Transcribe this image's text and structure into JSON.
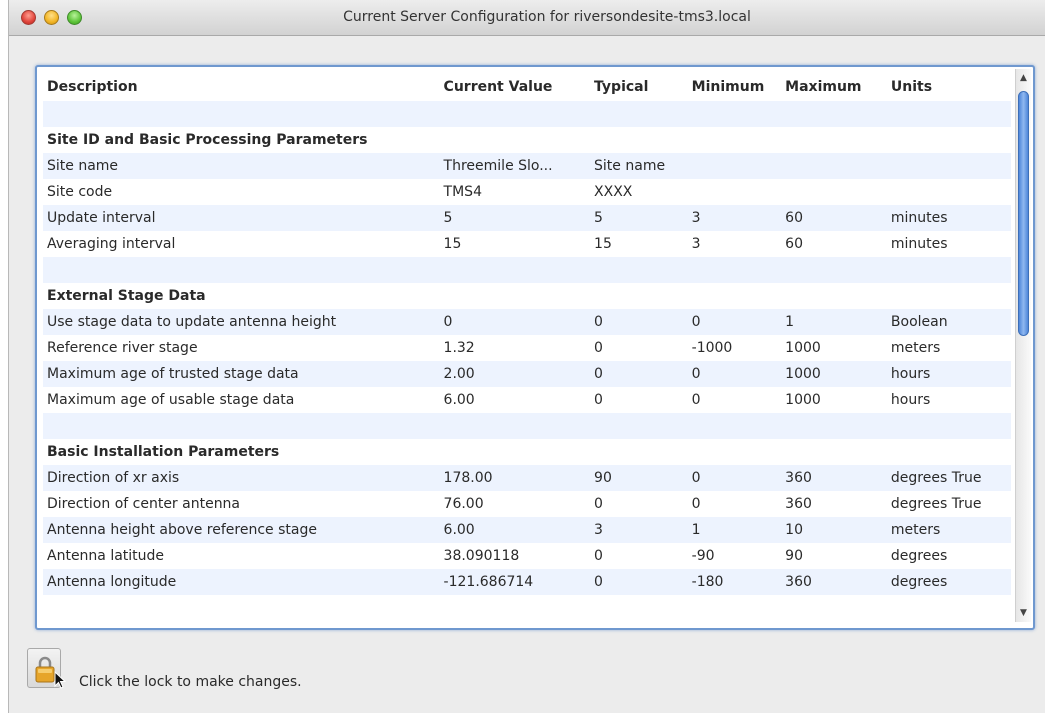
{
  "window": {
    "title": "Current Server Configuration for riversondesite-tms3.local"
  },
  "table": {
    "headers": [
      "Description",
      "Current Value",
      "Typical",
      "Minimum",
      "Maximum",
      "Units"
    ],
    "rows": [
      {
        "type": "blank",
        "cells": [
          "",
          "",
          "",
          "",
          "",
          ""
        ]
      },
      {
        "type": "section",
        "cells": [
          "Site ID and Basic Processing Parameters",
          "",
          "",
          "",
          "",
          ""
        ]
      },
      {
        "type": "data",
        "cells": [
          "Site name",
          "Threemile Slo...",
          "Site name",
          "",
          "",
          ""
        ]
      },
      {
        "type": "data",
        "cells": [
          "Site code",
          "TMS4",
          "XXXX",
          "",
          "",
          ""
        ]
      },
      {
        "type": "data",
        "cells": [
          "Update interval",
          "5",
          "5",
          "3",
          "60",
          "minutes"
        ]
      },
      {
        "type": "data",
        "cells": [
          "Averaging interval",
          "15",
          "15",
          "3",
          "60",
          "minutes"
        ]
      },
      {
        "type": "blank",
        "cells": [
          "",
          "",
          "",
          "",
          "",
          ""
        ]
      },
      {
        "type": "section",
        "cells": [
          "External Stage Data",
          "",
          "",
          "",
          "",
          ""
        ]
      },
      {
        "type": "data",
        "cells": [
          "Use stage data to update antenna height",
          "0",
          "0",
          "0",
          "1",
          "Boolean"
        ]
      },
      {
        "type": "data",
        "cells": [
          "Reference river stage",
          "1.32",
          "0",
          "-1000",
          "1000",
          "meters"
        ]
      },
      {
        "type": "data",
        "cells": [
          "Maximum age of trusted stage data",
          "2.00",
          "0",
          "0",
          "1000",
          "hours"
        ]
      },
      {
        "type": "data",
        "cells": [
          "Maximum age of usable stage data",
          "6.00",
          "0",
          "0",
          "1000",
          "hours"
        ]
      },
      {
        "type": "blank",
        "cells": [
          "",
          "",
          "",
          "",
          "",
          ""
        ]
      },
      {
        "type": "section",
        "cells": [
          "Basic Installation Parameters",
          "",
          "",
          "",
          "",
          ""
        ]
      },
      {
        "type": "data",
        "cells": [
          "Direction of xr axis",
          "178.00",
          "90",
          "0",
          "360",
          "degrees True"
        ]
      },
      {
        "type": "data",
        "cells": [
          "Direction of center antenna",
          "76.00",
          "0",
          "0",
          "360",
          "degrees True"
        ]
      },
      {
        "type": "data",
        "cells": [
          "Antenna height above reference stage",
          "6.00",
          "3",
          "1",
          "10",
          "meters"
        ]
      },
      {
        "type": "data",
        "cells": [
          "Antenna latitude",
          "38.090118",
          "0",
          "-90",
          "90",
          "degrees"
        ]
      },
      {
        "type": "data",
        "cells": [
          "Antenna longitude",
          "-121.686714",
          "0",
          "-180",
          "360",
          "degrees"
        ]
      },
      {
        "type": "blank",
        "cells": [
          "",
          "",
          "",
          "",
          "",
          ""
        ]
      }
    ]
  },
  "scrollbar": {
    "up_arrow": "▲",
    "down_arrow": "▼"
  },
  "footer": {
    "lock_message": "Click the lock to make changes."
  },
  "icons": {
    "lock": "lock-icon",
    "cursor": "cursor-icon"
  },
  "colors": {
    "row_stripe": "#edf3fe",
    "focus_border": "#6f98cf",
    "lock": "#e6a52a"
  }
}
